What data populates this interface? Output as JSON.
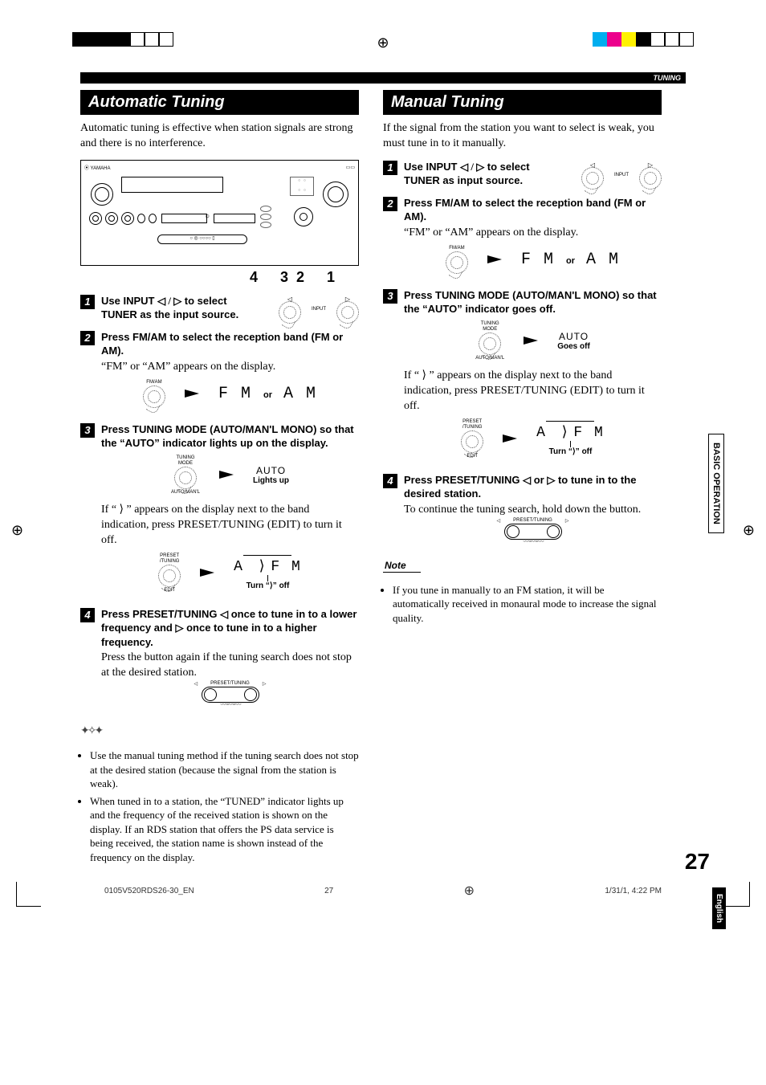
{
  "header": {
    "section_tag": "TUNING"
  },
  "registration_colors": [
    "#000",
    "#000",
    "#000",
    "#000",
    "#fff",
    "#fff",
    "#fff",
    "#00aeef",
    "#ec008c",
    "#fff200",
    "#000",
    "#fff",
    "#fff",
    "#fff"
  ],
  "automatic": {
    "title": "Automatic Tuning",
    "intro": "Automatic tuning is effective when station signals are strong and there is no interference.",
    "callouts": [
      "4",
      "3",
      "2",
      "1"
    ],
    "steps": [
      {
        "num": "1",
        "heading_pre": "Use INPUT ",
        "heading_mid": "◁ / ▷",
        "heading_post": " to select TUNER as the input source.",
        "sub": "",
        "input_label": "INPUT"
      },
      {
        "num": "2",
        "heading": "Press FM/AM to select the reception band (FM or AM).",
        "sub": "“FM” or “AM” appears on the display.",
        "btn_label": "FM/AM",
        "seg_fm": "F M",
        "seg_or": "or",
        "seg_am": "A M"
      },
      {
        "num": "3",
        "heading": "Press TUNING MODE (AUTO/MAN'L MONO) so that the “AUTO” indicator lights up on the display.",
        "btn_top": "TUNING",
        "btn_mid": "MODE",
        "btn_bot": "AUTO/MAN'L",
        "right_text_main": "AUTO",
        "right_text_sub": "Lights up",
        "sub": "If “ ⟩ ” appears on the display next to the band indication, press PRESET/TUNING (EDIT) to turn it off.",
        "btn2_top": "PRESET",
        "btn2_mid": "/TUNING",
        "btn2_bot": "EDIT",
        "disp_a": "A",
        "disp_colon": "⟩",
        "disp_band": "F M",
        "disp_caption_pre": "Turn “",
        "disp_caption_sym": "⟩",
        "disp_caption_post": "” off"
      },
      {
        "num": "4",
        "heading_pre": "Press PRESET/TUNING ",
        "heading_sym1": "◁",
        "heading_mid": " once to tune in to a lower frequency and ",
        "heading_sym2": "▷",
        "heading_post": " once to tune in to a higher frequency.",
        "sub": "Press the button again if the tuning search does not stop at the desired station.",
        "preset_label": "PRESET/TUNING"
      }
    ],
    "tips": [
      "Use the manual tuning method if the tuning search does not stop at the desired station (because the signal from the station is weak).",
      "When tuned in to a station, the “TUNED” indicator lights up and the frequency of the received station is shown on the display. If an RDS station that offers the PS data service is being received, the station name is shown instead of the frequency on the display."
    ]
  },
  "manual": {
    "title": "Manual Tuning",
    "intro": "If the signal from the station you want to select is weak, you must tune in to it manually.",
    "steps": [
      {
        "num": "1",
        "heading_pre": "Use INPUT ",
        "heading_mid": "◁ / ▷",
        "heading_post": " to select TUNER as input source.",
        "input_label": "INPUT"
      },
      {
        "num": "2",
        "heading": "Press FM/AM to select the reception band (FM or AM).",
        "sub": "“FM” or “AM” appears on the display.",
        "btn_label": "FM/AM",
        "seg_fm": "F M",
        "seg_or": "or",
        "seg_am": "A M"
      },
      {
        "num": "3",
        "heading": "Press TUNING MODE (AUTO/MAN'L MONO) so that the “AUTO” indicator goes off.",
        "btn_top": "TUNING",
        "btn_mid": "MODE",
        "btn_bot": "AUTO/MAN'L",
        "right_text_main": "AUTO",
        "right_text_sub": "Goes off",
        "sub": "If “ ⟩ ” appears on the display next to the band indication, press PRESET/TUNING (EDIT) to turn it off.",
        "btn2_top": "PRESET",
        "btn2_mid": "/TUNING",
        "btn2_bot": "EDIT",
        "disp_a": "A",
        "disp_colon": "⟩",
        "disp_band": "F M",
        "disp_caption_pre": "Turn “",
        "disp_caption_sym": "⟩",
        "disp_caption_post": "” off"
      },
      {
        "num": "4",
        "heading_pre": "Press PRESET/TUNING ",
        "heading_sym1": "◁",
        "heading_mid": " or ",
        "heading_sym2": "▷",
        "heading_post": " to tune in to the desired station.",
        "sub": "To continue the tuning search, hold down the button.",
        "preset_label": "PRESET/TUNING"
      }
    ],
    "note_label": "Note",
    "notes": [
      "If you tune in manually to an FM station, it will be automatically received in monaural mode to increase the signal quality."
    ]
  },
  "side": {
    "tab1": "BASIC OPERATION",
    "tab2": "English"
  },
  "page_number": "27",
  "footer": {
    "left": "0105V520RDS26-30_EN",
    "center": "27",
    "right": "1/31/1, 4:22 PM"
  }
}
